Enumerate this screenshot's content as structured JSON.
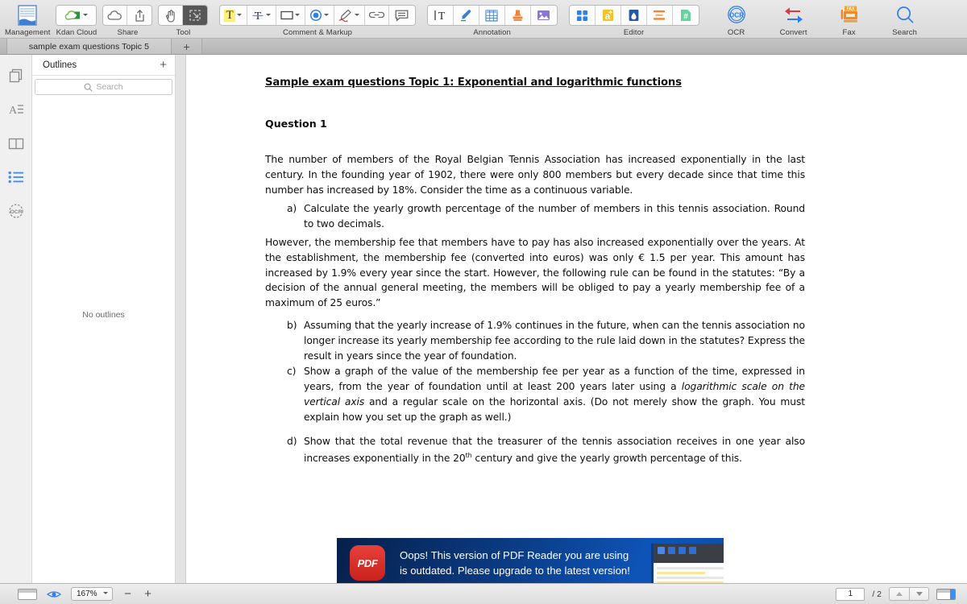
{
  "toolbar": {
    "groups": [
      {
        "name": "management",
        "label": "Management",
        "icon": "document-management-icon"
      },
      {
        "name": "kdan-cloud",
        "label": "Kdan Cloud",
        "icon": "cloud-upload-icon",
        "has_caret": true
      },
      {
        "name": "share",
        "label": "Share",
        "icons": [
          "cloud-icon",
          "share-upload-icon"
        ]
      },
      {
        "name": "tool",
        "label": "Tool",
        "icons": [
          "hand-tool-icon",
          "select-area-icon"
        ]
      },
      {
        "name": "comment-markup",
        "label": "Comment & Markup",
        "icons": [
          "highlight-text-icon",
          "strikethrough-text-icon",
          "rectangle-shape-icon",
          "circle-shape-icon",
          "ink-pen-icon",
          "link-icon",
          "sticky-note-icon"
        ]
      },
      {
        "name": "annotation",
        "label": "Annotation",
        "icons": [
          "text-box-icon",
          "signature-icon",
          "table-icon",
          "stamp-icon",
          "image-icon"
        ]
      },
      {
        "name": "editor",
        "label": "Editor",
        "icons": [
          "page-edit-icon",
          "text-edit-icon",
          "watermark-icon",
          "header-footer-icon",
          "bates-numbering-icon"
        ]
      },
      {
        "name": "ocr",
        "label": "OCR",
        "icon": "ocr-icon"
      },
      {
        "name": "convert",
        "label": "Convert",
        "icon": "convert-arrows-icon"
      },
      {
        "name": "fax",
        "label": "Fax",
        "icon": "fax-machine-icon"
      },
      {
        "name": "search",
        "label": "Search",
        "icon": "magnifier-icon"
      }
    ]
  },
  "tabs": {
    "items": [
      {
        "label": "sample exam questions Topic 5",
        "active": true
      }
    ],
    "add_label": "+"
  },
  "rail": {
    "items": [
      {
        "name": "thumbnails",
        "icon": "pages-thumbnail-icon",
        "active": false
      },
      {
        "name": "annotations",
        "icon": "annotation-list-icon",
        "active": false
      },
      {
        "name": "bookmarks",
        "icon": "book-icon",
        "active": false
      },
      {
        "name": "outlines",
        "icon": "outline-list-icon",
        "active": true
      },
      {
        "name": "ocr-results",
        "icon": "ocr-circle-icon",
        "active": false
      }
    ]
  },
  "sidebar": {
    "title": "Outlines",
    "add_label": "+",
    "search_placeholder": "Search",
    "empty_text": "No outlines",
    "accent_color": "#3b8df0"
  },
  "document": {
    "title": "Sample exam questions Topic 1: Exponential and logarithmic functions",
    "question_heading": "Question 1",
    "paragraph_1": "The number of members of the Royal Belgian Tennis Association has increased exponentially in the last century. In the founding year of 1902, there were only 800 members but every decade since that time this number has increased by 18%. Consider the time as a continuous variable.",
    "item_a_marker": "a)",
    "item_a_text": "Calculate the yearly growth percentage of the number of members in this tennis association. Round to two decimals.",
    "paragraph_2": "However, the membership fee that members have to pay has also increased exponentially over the years. At the establishment, the membership fee (converted into euros) was only € 1.5 per year. This amount has increased by 1.9% every year since the start. However, the following rule can be found in the statutes: “By a decision of the annual general meeting, the members will be obliged to pay a yearly membership fee of a maximum of 25 euros.”",
    "item_b_marker": "b)",
    "item_b_text": "Assuming that the yearly increase of 1.9% continues in the future, when can the tennis association no longer increase its yearly membership fee according to the rule laid down in the statutes? Express the result in years since the year of foundation.",
    "item_c_marker": "c)",
    "item_c_text_1": "Show a graph of the value of the membership fee per year as a function of the time, expressed in years,  from the year of foundation until at least 200 years later using a ",
    "item_c_italic_1": "logarithmic scale on the vertical axis",
    "item_c_text_2": " and a regular scale on the horizontal axis. (Do not merely show the graph. You must explain how you set up the graph as well.)",
    "item_d_marker": "d)",
    "item_d_text_1": "Show that the total revenue that the treasurer of the tennis association receives in one year also increases exponentially in the 20",
    "item_d_sup": "th",
    "item_d_text_2": " century and give the yearly growth percentage of this."
  },
  "banner": {
    "logo_text": "PDF",
    "line_1": "Oops! This version of PDF Reader you are using",
    "line_2": "is outdated. Please upgrade to the latest version!"
  },
  "statusbar": {
    "view_mode_icon": "single-page-view-icon",
    "eye_icon": "preview-eye-icon",
    "zoom_value": "167%",
    "zoom_out_label": "−",
    "zoom_in_label": "+",
    "page_number": "1",
    "page_total": "/ 2",
    "prev_page_icon": "triangle-up-icon",
    "next_page_icon": "triangle-down-icon",
    "panel_toggle_icon": "split-view-icon"
  }
}
